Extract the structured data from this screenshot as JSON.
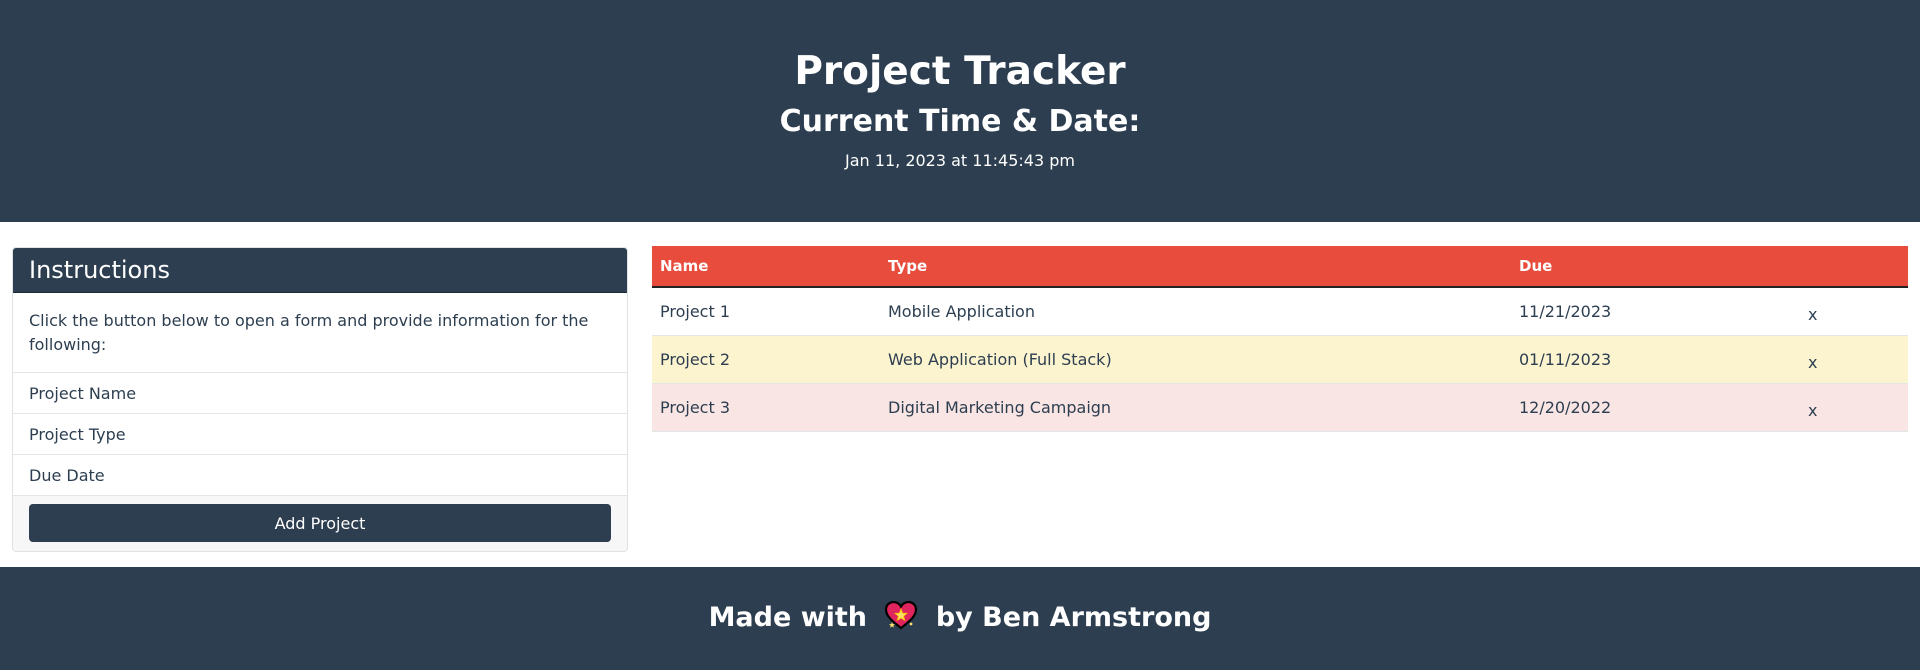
{
  "header": {
    "title": "Project Tracker",
    "subtitle": "Current Time & Date:",
    "datetime": "Jan 11, 2023 at 11:45:43 pm"
  },
  "instructions": {
    "title": "Instructions",
    "body": "Click the button below to open a form and provide information for the following:",
    "items": [
      "Project Name",
      "Project Type",
      "Due Date"
    ],
    "button_label": "Add Project"
  },
  "table": {
    "headers": [
      "Name",
      "Type",
      "Due",
      ""
    ],
    "rows": [
      {
        "name": "Project 1",
        "type": "Mobile Application",
        "due": "11/21/2023",
        "delete": "x"
      },
      {
        "name": "Project 2",
        "type": "Web Application (Full Stack)",
        "due": "01/11/2023",
        "delete": "x"
      },
      {
        "name": "Project 3",
        "type": "Digital Marketing Campaign",
        "due": "12/20/2022",
        "delete": "x"
      }
    ]
  },
  "footer": {
    "prefix": "Made with",
    "icon": "sparkling-heart-icon",
    "suffix": "by Ben Armstrong"
  },
  "colors": {
    "primary": "#2c3e50",
    "header_accent": "#e74c3c",
    "row_today": "#fcf3cf",
    "row_past": "#f9e5e3"
  }
}
